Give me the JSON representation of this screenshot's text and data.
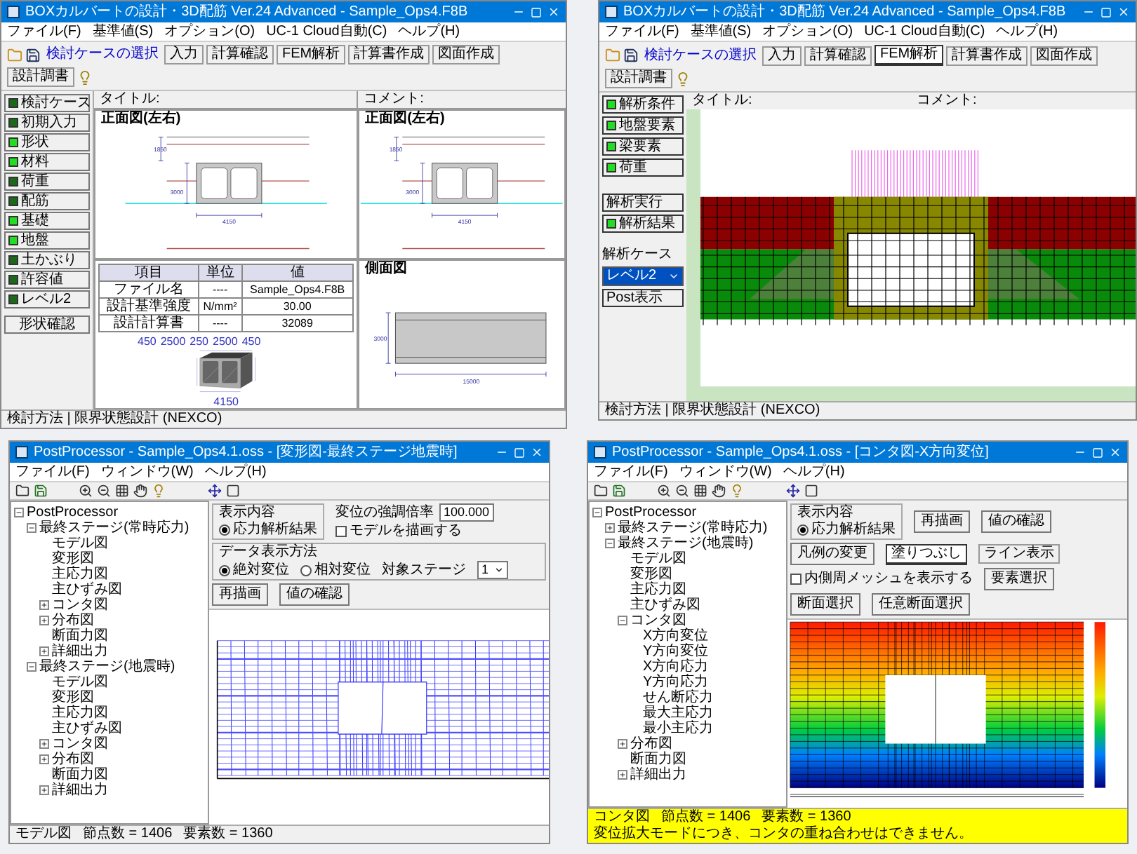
{
  "design_window": {
    "title": "BOXカルバートの設計・3D配筋 Ver.24 Advanced - Sample_Ops4.F8B",
    "menus": [
      "ファイル(F)",
      "基準値(S)",
      "オプション(O)",
      "UC-1 Cloud自動(C)",
      "ヘルプ(H)"
    ],
    "case_select": "検討ケースの選択",
    "tools": [
      {
        "label": "入力",
        "selected": false
      },
      {
        "label": "計算確認",
        "selected": false
      },
      {
        "label": "FEM解析",
        "selected": false
      },
      {
        "label": "計算書作成",
        "selected": false
      },
      {
        "label": "図面作成",
        "selected": false
      },
      {
        "label": "設計調書",
        "selected": false
      }
    ],
    "side_buttons": [
      {
        "label": "検討ケース",
        "done": false
      },
      {
        "label": "初期入力",
        "done": false
      },
      {
        "label": "形状",
        "done": true
      },
      {
        "label": "材料",
        "done": true
      },
      {
        "label": "荷重",
        "done": false
      },
      {
        "label": "配筋",
        "done": false
      },
      {
        "label": "基礎",
        "done": true
      },
      {
        "label": "地盤",
        "done": true
      },
      {
        "label": "土かぶり",
        "done": false
      },
      {
        "label": "許容値",
        "done": false
      },
      {
        "label": "レベル2",
        "done": false
      }
    ],
    "side_note": "形状確認",
    "title_label": "タイトル:",
    "comment_label": "コメント:",
    "views": [
      {
        "kind": "front",
        "label": "正面図(左右)",
        "dims": [
          "1850",
          "3000",
          "4150"
        ]
      },
      {
        "kind": "front",
        "label": "正面図(左右)",
        "dims": [
          "1850",
          "3000",
          "4150"
        ]
      },
      {
        "kind": "iso",
        "dims": [
          "450",
          "2500",
          "250",
          "2500",
          "450",
          "4150"
        ],
        "table": [
          [
            "項目",
            "単位",
            "値"
          ],
          [
            "ファイル名",
            "----",
            "Sample_Ops4.F8B"
          ],
          [
            "設計基準強度",
            "N/mm²",
            "30.00"
          ],
          [
            "設計計算書",
            "----",
            "32089"
          ]
        ]
      },
      {
        "kind": "side",
        "label": "側面図",
        "dims": [
          "3000",
          "15000"
        ]
      }
    ],
    "status": "検討方法 | 限界状態設計 (NEXCO)"
  },
  "fem_window": {
    "title": "BOXカルバートの設計・3D配筋 Ver.24 Advanced - Sample_Ops4.F8B",
    "menus": [
      "ファイル(F)",
      "基準値(S)",
      "オプション(O)",
      "UC-1 Cloud自動(C)",
      "ヘルプ(H)"
    ],
    "case_select": "検討ケースの選択",
    "tools": [
      {
        "label": "入力",
        "selected": false
      },
      {
        "label": "計算確認",
        "selected": false
      },
      {
        "label": "FEM解析",
        "selected": true
      },
      {
        "label": "計算書作成",
        "selected": false
      },
      {
        "label": "図面作成",
        "selected": false
      },
      {
        "label": "設計調書",
        "selected": false
      }
    ],
    "side_buttons": [
      {
        "label": "解析条件",
        "done": true
      },
      {
        "label": "地盤要素",
        "done": true
      },
      {
        "label": "梁要素",
        "done": true
      },
      {
        "label": "荷重",
        "done": true
      }
    ],
    "run_button": "解析実行",
    "result_button": {
      "label": "解析結果",
      "done": true
    },
    "case_label": "解析ケース",
    "case_value": "レベル2",
    "post_button": "Post表示",
    "title_label": "タイトル:",
    "comment_label": "コメント:",
    "status": "検討方法 | 限界状態設計 (NEXCO)"
  },
  "mesh_window": {
    "title": "PostProcessor - Sample_Ops4.1.oss - [変形図-最終ステージ地震時]",
    "menus": [
      "ファイル(F)",
      "ウィンドウ(W)",
      "ヘルプ(H)"
    ],
    "tree": [
      {
        "label": "PostProcessor",
        "expanded": true,
        "children": [
          {
            "label": "最終ステージ(常時応力)",
            "expanded": true,
            "children": [
              {
                "label": "モデル図"
              },
              {
                "label": "変形図"
              },
              {
                "label": "主応力図"
              },
              {
                "label": "主ひずみ図"
              },
              {
                "label": "コンタ図",
                "expanded": false
              },
              {
                "label": "分布図",
                "expanded": false
              },
              {
                "label": "断面力図"
              },
              {
                "label": "詳細出力",
                "expanded": false
              }
            ]
          },
          {
            "label": "最終ステージ(地震時)",
            "expanded": true,
            "children": [
              {
                "label": "モデル図"
              },
              {
                "label": "変形図"
              },
              {
                "label": "主応力図"
              },
              {
                "label": "主ひずみ図"
              },
              {
                "label": "コンタ図",
                "expanded": false
              },
              {
                "label": "分布図",
                "expanded": false
              },
              {
                "label": "断面力図"
              },
              {
                "label": "詳細出力",
                "expanded": false
              }
            ]
          }
        ]
      }
    ],
    "display_group": "表示内容",
    "display_option": {
      "label": "応力解析結果",
      "selected": true
    },
    "scale_label": "変位の強調倍率",
    "scale_value": "100.000",
    "model_check": {
      "label": "モデルを描画する",
      "checked": false
    },
    "method_group": "データ表示方法",
    "methods": [
      {
        "label": "絶対変位",
        "selected": true
      },
      {
        "label": "相対変位",
        "selected": false
      }
    ],
    "stage_label": "対象ステージ",
    "stage_value": "1",
    "buttons": [
      "再描画",
      "値の確認"
    ],
    "status": [
      "モデル図",
      "節点数 = 1406",
      "要素数 = 1360"
    ]
  },
  "contour_window": {
    "title": "PostProcessor - Sample_Ops4.1.oss - [コンタ図-X方向変位]",
    "menus": [
      "ファイル(F)",
      "ウィンドウ(W)",
      "ヘルプ(H)"
    ],
    "tree": [
      {
        "label": "PostProcessor",
        "expanded": true,
        "children": [
          {
            "label": "最終ステージ(常時応力)",
            "expanded": false
          },
          {
            "label": "最終ステージ(地震時)",
            "expanded": true,
            "children": [
              {
                "label": "モデル図"
              },
              {
                "label": "変形図"
              },
              {
                "label": "主応力図"
              },
              {
                "label": "主ひずみ図"
              },
              {
                "label": "コンタ図",
                "expanded": true,
                "children": [
                  {
                    "label": "X方向変位"
                  },
                  {
                    "label": "Y方向変位"
                  },
                  {
                    "label": "X方向応力"
                  },
                  {
                    "label": "Y方向応力"
                  },
                  {
                    "label": "せん断応力"
                  },
                  {
                    "label": "最大主応力"
                  },
                  {
                    "label": "最小主応力"
                  }
                ]
              },
              {
                "label": "分布図",
                "expanded": false
              },
              {
                "label": "断面力図"
              },
              {
                "label": "詳細出力",
                "expanded": false
              }
            ]
          }
        ]
      }
    ],
    "display_group": "表示内容",
    "display_option": {
      "label": "応力解析結果",
      "selected": true
    },
    "buttons": [
      "再描画",
      "値の確認"
    ],
    "legend_button": "凡例の変更",
    "modes": [
      {
        "label": "塗りつぶし",
        "selected": true
      },
      {
        "label": "ライン表示",
        "selected": false
      }
    ],
    "mesh_check": {
      "label": "内側周メッシュを表示する",
      "checked": false
    },
    "selectors": [
      "要素選択",
      "断面選択",
      "任意断面選択"
    ],
    "status": [
      "コンタ図",
      "節点数 = 1406",
      "要素数 = 1360",
      "変位拡大モードにつき、コンタの重ね合わせはできません。"
    ]
  }
}
